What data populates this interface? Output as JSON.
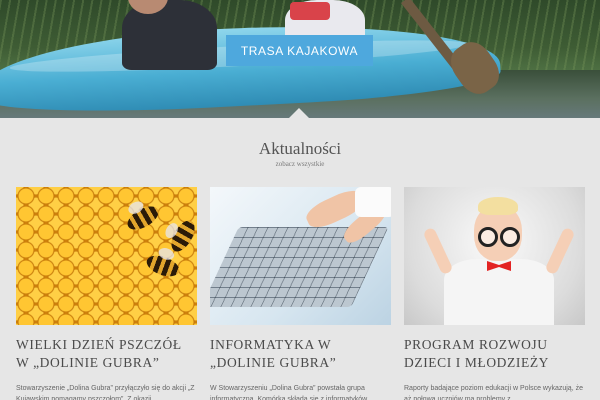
{
  "hero": {
    "button_label": "TRASA KAJAKOWA"
  },
  "news": {
    "heading": "Aktualności",
    "see_all": "zobacz wszystkie",
    "items": [
      {
        "title_line1": "WIELKI DZIEŃ PSZCZÓŁ",
        "title_line2": "W „DOLINIE GUBRA”",
        "excerpt": "Stowarzyszenie „Dolina Gubra” przyłączyło się do akcji „Z Kujawskim pomagamy pszczołom”. Z okazji"
      },
      {
        "title_line1": "INFORMATYKA W",
        "title_line2": "„DOLINIE GUBRA”",
        "excerpt": "W Stowarzyszeniu „Dolina Gubra” powstała grupa informatyczna. Komórka składa się z informatyków,"
      },
      {
        "title_line1": "PROGRAM ROZWOJU",
        "title_line2": "DZIECI I MŁODZIEŻY",
        "excerpt": "Raporty badające poziom edukacji w Polsce wykazują, że aż połowa uczniów ma problemy z"
      }
    ]
  },
  "colors": {
    "accent": "#4ea8dd",
    "background": "#e6e6e6",
    "title_text": "#4a4a4a"
  },
  "icons": [
    "bee-image",
    "laptop-image",
    "boy-image"
  ]
}
